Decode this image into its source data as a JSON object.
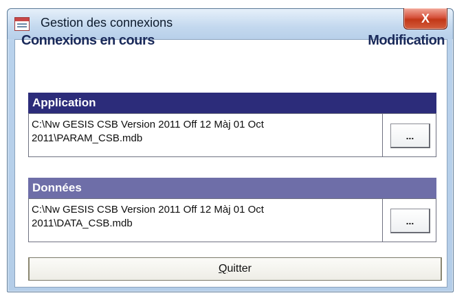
{
  "window": {
    "title": "Gestion des connexions",
    "close_label": "X"
  },
  "headers": {
    "left": "Connexions en cours",
    "right": "Modification"
  },
  "application": {
    "label": "Application",
    "path": "C:\\Nw GESIS CSB Version 2011 Off 12 Màj 01 Oct\n2011\\PARAM_CSB.mdb",
    "button_label": "..."
  },
  "donnees": {
    "label": "Données",
    "path": "C:\\Nw GESIS CSB Version 2011 Off 12 Màj 01 Oct\n2011\\DATA_CSB.mdb",
    "button_label": "..."
  },
  "quit_button": {
    "mnemonic": "Q",
    "rest": "uitter"
  }
}
